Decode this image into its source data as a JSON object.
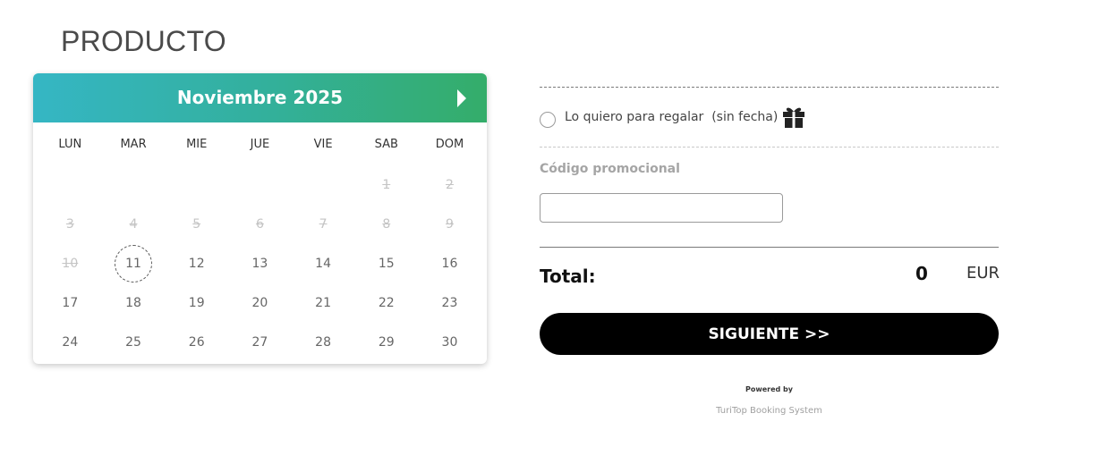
{
  "page": {
    "title": "PRODUCTO"
  },
  "calendar": {
    "month_label": "Noviembre 2025",
    "weekdays": [
      "LUN",
      "MAR",
      "MIE",
      "JUE",
      "VIE",
      "SAB",
      "DOM"
    ],
    "weeks": [
      [
        {
          "d": ""
        },
        {
          "d": ""
        },
        {
          "d": ""
        },
        {
          "d": ""
        },
        {
          "d": ""
        },
        {
          "d": "1",
          "disabled": true
        },
        {
          "d": "2",
          "disabled": true
        }
      ],
      [
        {
          "d": "3",
          "disabled": true
        },
        {
          "d": "4",
          "disabled": true
        },
        {
          "d": "5",
          "disabled": true
        },
        {
          "d": "6",
          "disabled": true
        },
        {
          "d": "7",
          "disabled": true
        },
        {
          "d": "8",
          "disabled": true
        },
        {
          "d": "9",
          "disabled": true
        }
      ],
      [
        {
          "d": "10",
          "disabled": true
        },
        {
          "d": "11",
          "today": true
        },
        {
          "d": "12"
        },
        {
          "d": "13"
        },
        {
          "d": "14"
        },
        {
          "d": "15"
        },
        {
          "d": "16"
        }
      ],
      [
        {
          "d": "17"
        },
        {
          "d": "18"
        },
        {
          "d": "19"
        },
        {
          "d": "20"
        },
        {
          "d": "21"
        },
        {
          "d": "22"
        },
        {
          "d": "23"
        }
      ],
      [
        {
          "d": "24"
        },
        {
          "d": "25"
        },
        {
          "d": "26"
        },
        {
          "d": "27"
        },
        {
          "d": "28"
        },
        {
          "d": "29"
        },
        {
          "d": "30"
        }
      ]
    ],
    "next_icon": "caret-right-icon"
  },
  "gift": {
    "label": "Lo quiero para regalar  (sin fecha)",
    "checked": false,
    "icon": "gift-icon"
  },
  "promo": {
    "label": "Código promocional",
    "value": "",
    "placeholder": ""
  },
  "total": {
    "label": "Total:",
    "value": "0",
    "currency": "EUR"
  },
  "actions": {
    "next_label": "SIGUIENTE >>"
  },
  "footer": {
    "powered_by": "Powered by",
    "brand": "TuriTop Booking System"
  },
  "colors": {
    "header_gradient_start": "#35b6c4",
    "header_gradient_end": "#34ad6a",
    "button": "#000000"
  }
}
